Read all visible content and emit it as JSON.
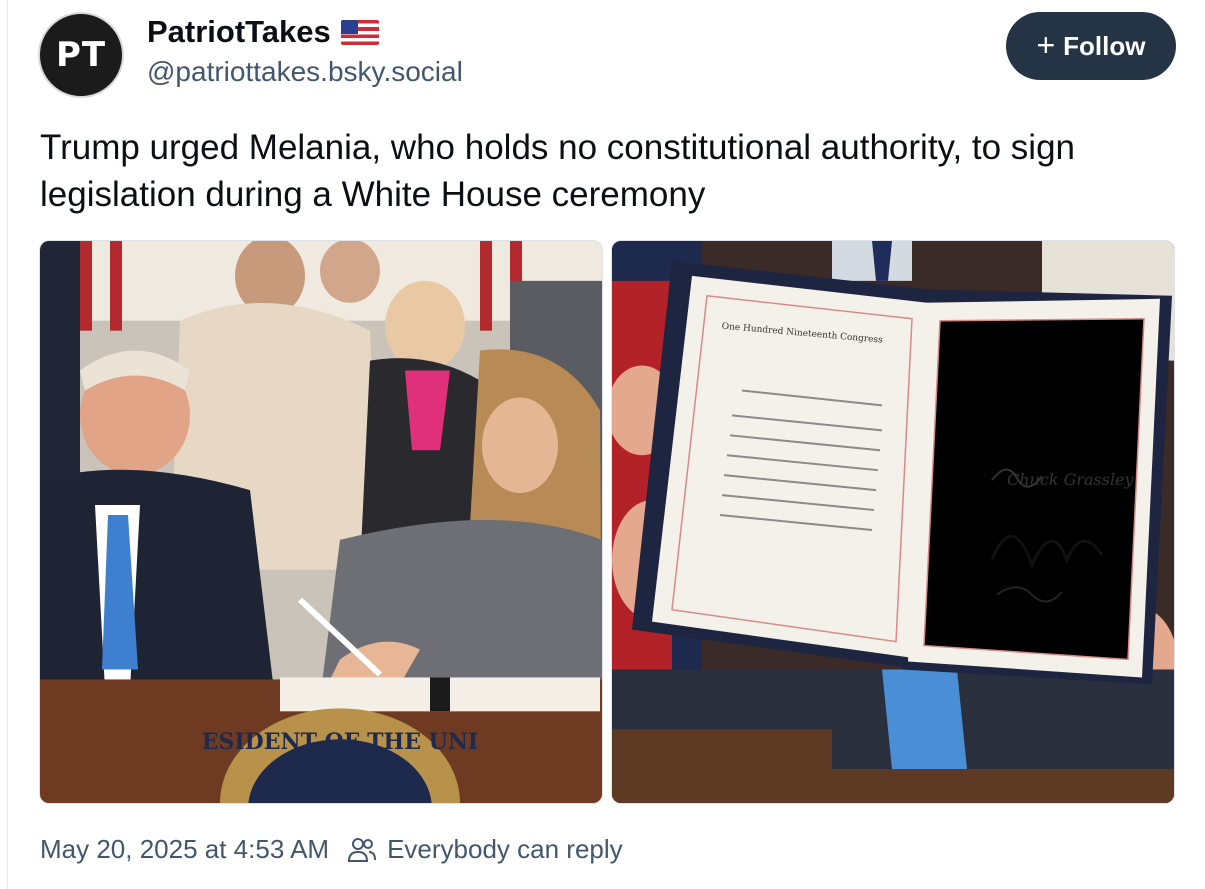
{
  "author": {
    "avatar_text": "PT",
    "display_name": "PatriotTakes",
    "handle": "@patriottakes.bsky.social",
    "badge_icon": "us-flag-icon"
  },
  "follow_button": {
    "label": "Follow",
    "icon": "plus-icon"
  },
  "post": {
    "text": "Trump urged Melania, who holds no constitutional authority, to sign legislation during a White House ceremony"
  },
  "images": [
    {
      "seal_text": "ESIDENT OF THE UNI"
    },
    {
      "doc_header": "One Hundred Nineteenth Congress",
      "signature": "Chuck Grassley"
    }
  ],
  "footer": {
    "timestamp": "May 20, 2025 at 4:53 AM",
    "reply_icon": "people-icon",
    "reply_setting": "Everybody can reply"
  },
  "colors": {
    "button_bg": "#243444",
    "muted_text": "#42576c"
  }
}
